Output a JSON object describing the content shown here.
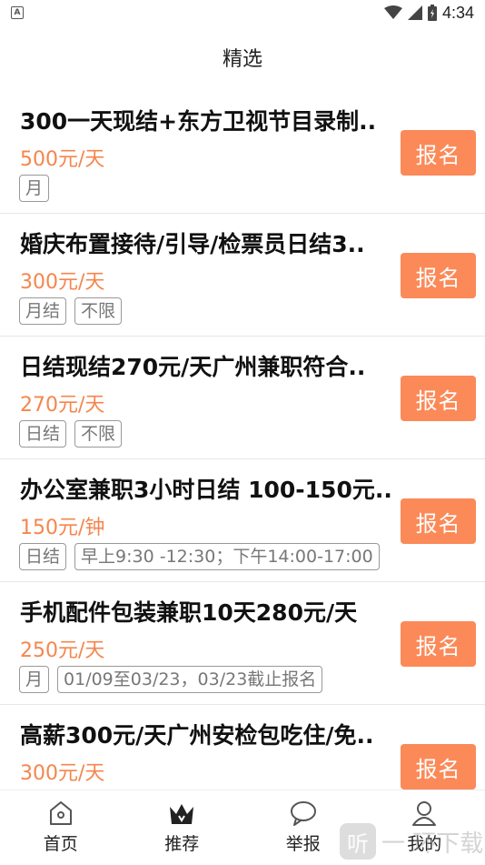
{
  "status_bar": {
    "time": "4:34",
    "app_badge": "A"
  },
  "header": {
    "title": "精选"
  },
  "jobs": [
    {
      "title": "300一天现结+东方卫视节目录制..",
      "price": "500元/天",
      "tags": [
        "月"
      ],
      "button": "报名"
    },
    {
      "title": "婚庆布置接待/引导/检票员日结3..",
      "price": "300元/天",
      "tags": [
        "月结",
        "不限"
      ],
      "button": "报名"
    },
    {
      "title": "日结现结270元/天广州兼职符合..",
      "price": "270元/天",
      "tags": [
        "日结",
        "不限"
      ],
      "button": "报名"
    },
    {
      "title": "办公室兼职3小时日结 100-150元..",
      "price": "150元/钟",
      "tags": [
        "日结",
        "早上9:30 -12:30；下午14:00-17:00"
      ],
      "button": "报名"
    },
    {
      "title": "手机配件包装兼职10天280元/天",
      "price": "250元/天",
      "tags": [
        "月",
        "01/09至03/23，03/23截止报名"
      ],
      "button": "报名"
    },
    {
      "title": "高薪300元/天广州安检包吃住/免..",
      "price": "300元/天",
      "tags": [],
      "button": "报名"
    }
  ],
  "bottom_nav": [
    {
      "label": "首页",
      "icon": "home-icon"
    },
    {
      "label": "推荐",
      "icon": "crown-icon"
    },
    {
      "label": "举报",
      "icon": "chat-bubble-icon"
    },
    {
      "label": "我的",
      "icon": "user-icon"
    }
  ],
  "watermark": {
    "badge": "听",
    "text": "一 环下载"
  },
  "colors": {
    "accent": "#fb8a58",
    "price": "#f5864d"
  }
}
